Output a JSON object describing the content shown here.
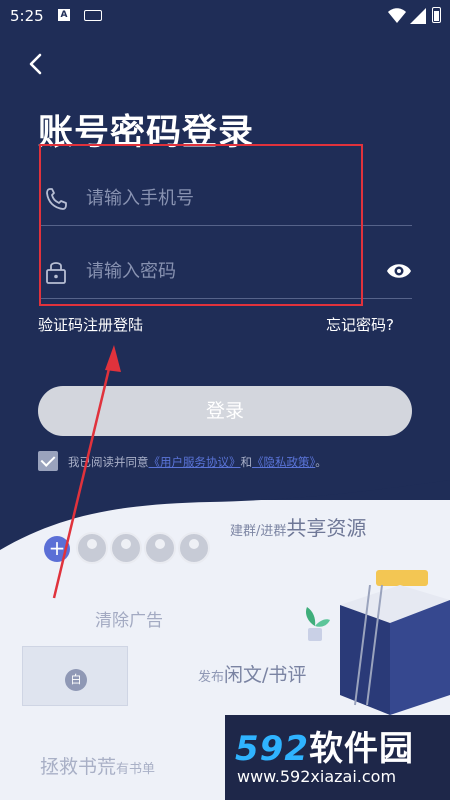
{
  "status_bar": {
    "time": "5:25",
    "notification_icons": [
      "a-icon",
      "keyboard-icon"
    ]
  },
  "page": {
    "title": "账号密码登录"
  },
  "form": {
    "phone_placeholder": "请输入手机号",
    "password_placeholder": "请输入密码"
  },
  "links": {
    "sms_register_login": "验证码注册登陆",
    "forgot_password": "忘记密码?"
  },
  "login_button": "登录",
  "agreement": {
    "prefix": "我已阅读并同意",
    "user_agreement": "《用户服务协议》",
    "and": "和",
    "privacy_policy": "《隐私政策》",
    "suffix": "。",
    "checked": true
  },
  "illustration": {
    "share_prefix": "建群/进群",
    "share_main": "共享资源",
    "clear_ads": "清除广告",
    "post_prefix": "发布",
    "post_main": "闲文/书评",
    "save_main": "拯救书荒",
    "save_suffix": "有书单",
    "card_badge": "白"
  },
  "watermark": {
    "digits": "592",
    "brand": "软件园",
    "url": "www.592xiazai.com"
  },
  "colors": {
    "navy": "#1f2d57",
    "highlight_box": "#e0323c",
    "arrow": "#e0323c",
    "link": "#5a74d8"
  }
}
